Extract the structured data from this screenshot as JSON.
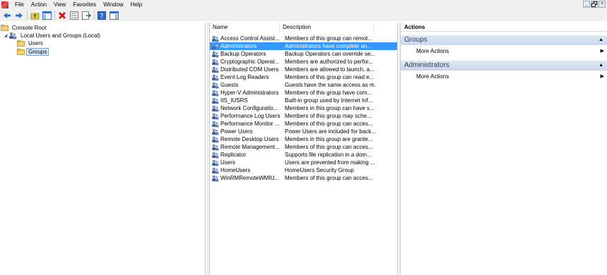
{
  "menu": {
    "items": [
      "File",
      "Action",
      "View",
      "Favorites",
      "Window",
      "Help"
    ]
  },
  "window_controls": {
    "minimize": "_",
    "restore": "ɑ",
    "close": "×"
  },
  "toolbar": {
    "buttons": [
      "back-icon",
      "forward-icon",
      "up-folder-icon",
      "show-hide-console-tree-icon",
      "delete-icon",
      "properties-icon",
      "export-list-icon",
      "help-icon",
      "show-hide-action-pane-icon"
    ]
  },
  "tree": {
    "items": [
      {
        "label": "Console Root",
        "icon": "folder-icon"
      },
      {
        "label": "Local Users and Groups (Local)",
        "icon": "users-groups-icon"
      },
      {
        "label": "Users",
        "icon": "folder-icon"
      },
      {
        "label": "Groups",
        "icon": "folder-icon",
        "selected": true
      }
    ]
  },
  "list": {
    "columns": [
      "Name",
      "Description"
    ],
    "rows": [
      {
        "name": "Access Control Assist...",
        "desc": "Members of this group can remot..."
      },
      {
        "name": "Administrators",
        "desc": "Administrators have complete an...",
        "selected": true
      },
      {
        "name": "Backup Operators",
        "desc": "Backup Operators can override se..."
      },
      {
        "name": "Cryptographic Operat...",
        "desc": "Members are authorized to perfor..."
      },
      {
        "name": "Distributed COM Users",
        "desc": "Members are allowed to launch, a..."
      },
      {
        "name": "Event Log Readers",
        "desc": "Members of this group can read e..."
      },
      {
        "name": "Guests",
        "desc": "Guests have the same access as m..."
      },
      {
        "name": "Hyper-V Administrators",
        "desc": "Members of this group have com..."
      },
      {
        "name": "IIS_IUSRS",
        "desc": "Built-in group used by Internet Inf..."
      },
      {
        "name": "Network Configuratio...",
        "desc": "Members in this group can have s..."
      },
      {
        "name": "Performance Log Users",
        "desc": "Members of this group may sche..."
      },
      {
        "name": "Performance Monitor ...",
        "desc": "Members of this group can acces..."
      },
      {
        "name": "Power Users",
        "desc": "Power Users are included for back..."
      },
      {
        "name": "Remote Desktop Users",
        "desc": "Members in this group are grante..."
      },
      {
        "name": "Remote Management...",
        "desc": "Members of this group can acces..."
      },
      {
        "name": "Replicator",
        "desc": "Supports file replication in a dom..."
      },
      {
        "name": "Users",
        "desc": "Users are prevented from making ..."
      },
      {
        "name": "HomeUsers",
        "desc": "HomeUsers Security Group"
      },
      {
        "name": "WinRMRemoteWMIU...",
        "desc": "Members of this group can acces..."
      }
    ]
  },
  "actions": {
    "header": "Actions",
    "sections": [
      {
        "title": "Groups",
        "items": [
          "More Actions"
        ]
      },
      {
        "title": "Administrators",
        "items": [
          "More Actions"
        ]
      }
    ]
  },
  "colors": {
    "selection": "#3399ff",
    "section_band": "#c9d8ec",
    "chrome": "#f0f0f0"
  }
}
